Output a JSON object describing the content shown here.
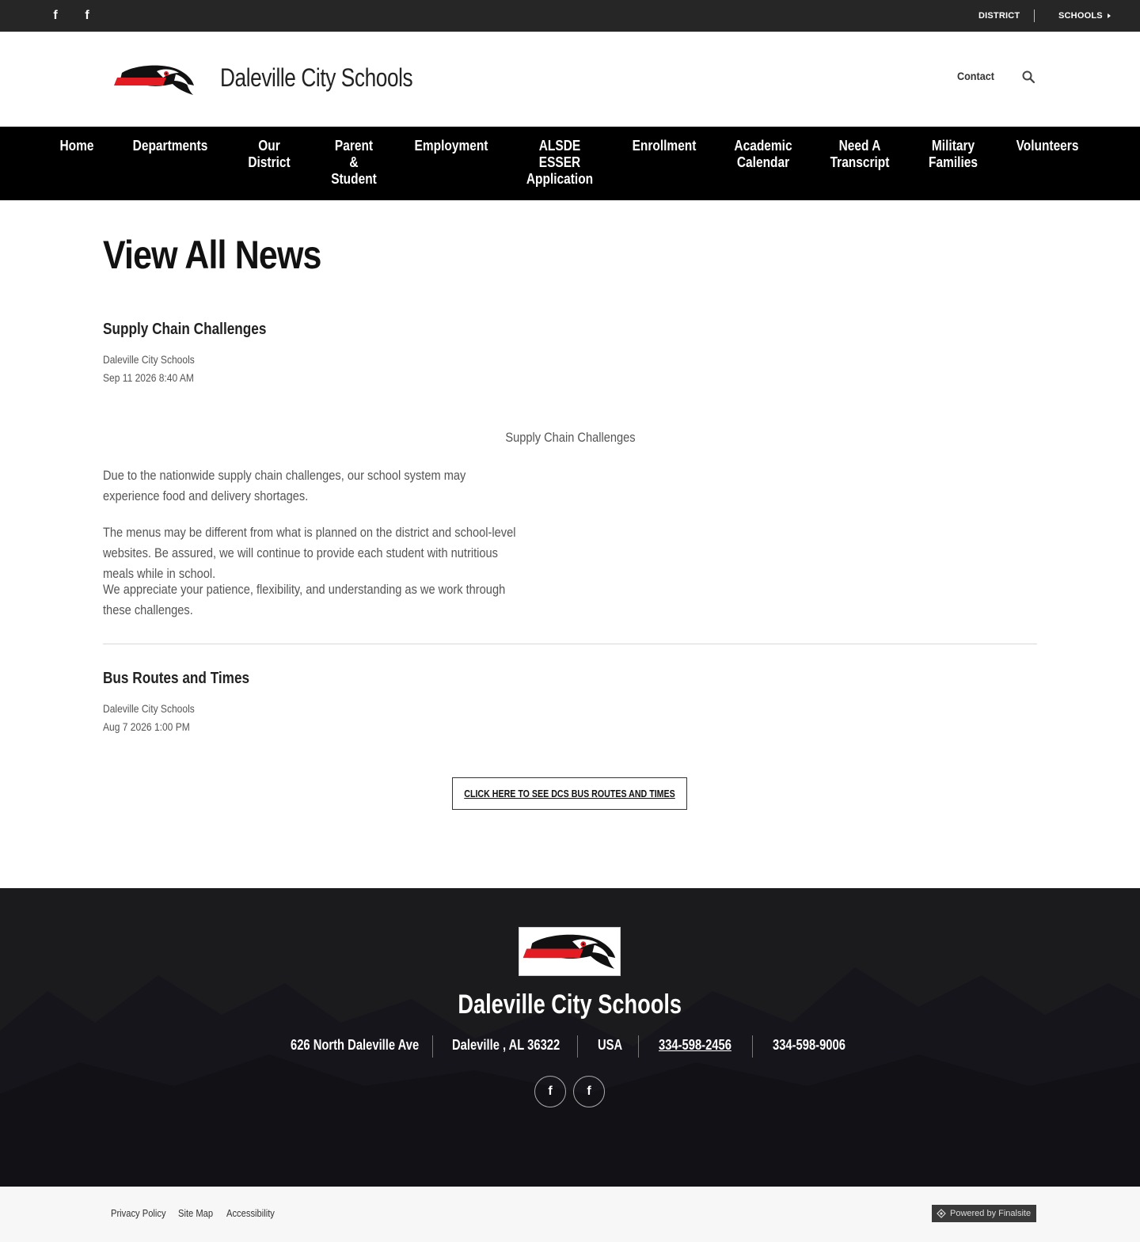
{
  "utility": {
    "social": [
      {
        "icon": "facebook-icon",
        "glyph": "f"
      },
      {
        "icon": "facebook-icon",
        "glyph": "f"
      }
    ],
    "district_label": "DISTRICT",
    "schools_label": "SCHOOLS"
  },
  "header": {
    "site_title": "Daleville City Schools",
    "contact_label": "Contact",
    "search_icon": "search-icon"
  },
  "nav": {
    "items": [
      {
        "label": "Home"
      },
      {
        "label": "Departments"
      },
      {
        "label": "Our\nDistrict"
      },
      {
        "label": "Parent\n&\nStudent"
      },
      {
        "label": "Employment"
      },
      {
        "label": "ALSDE\nESSER\nApplication"
      },
      {
        "label": "Enrollment"
      },
      {
        "label": "Academic\nCalendar"
      },
      {
        "label": "Need A\nTranscript"
      },
      {
        "label": "Military\nFamilies"
      },
      {
        "label": "Volunteers"
      }
    ]
  },
  "main": {
    "page_title": "View All News",
    "posts": [
      {
        "title": "Supply Chain Challenges",
        "author": "Daleville City Schools",
        "date": "Sep 11 2026 8:40 AM",
        "caption": "Supply Chain Challenges",
        "paragraphs": [
          "Due to the nationwide supply chain challenges, our school system may experience food and delivery shortages.",
          "The menus may be different from what is planned on the district and school-level websites. Be assured, we will continue to provide each student with nutritious meals while in school.",
          "We appreciate your patience, flexibility, and understanding as we work through these challenges."
        ]
      },
      {
        "title": "Bus Routes and Times",
        "author": "Daleville City Schools",
        "date": "Aug 7 2026 1:00 PM",
        "button_label": "CLICK HERE TO SEE DCS BUS ROUTES AND TIMES"
      }
    ]
  },
  "footer": {
    "title": "Daleville City Schools",
    "address": "626 North Daleville Ave",
    "city_state": "Daleville , AL  36322",
    "country": "USA",
    "phone": "334-598-2456",
    "fax": "334-598-9006",
    "social": [
      {
        "icon": "facebook-icon",
        "glyph": "f"
      },
      {
        "icon": "facebook-icon",
        "glyph": "f"
      }
    ]
  },
  "bottom": {
    "links": [
      "Privacy Policy",
      "Site Map",
      "Accessibility"
    ],
    "powered_by": "Powered by Finalsite"
  },
  "colors": {
    "accent_red": "#e31b23",
    "nav_bg": "#000000",
    "utility_bg": "#262626",
    "footer_bg": "#1b1b1e"
  }
}
